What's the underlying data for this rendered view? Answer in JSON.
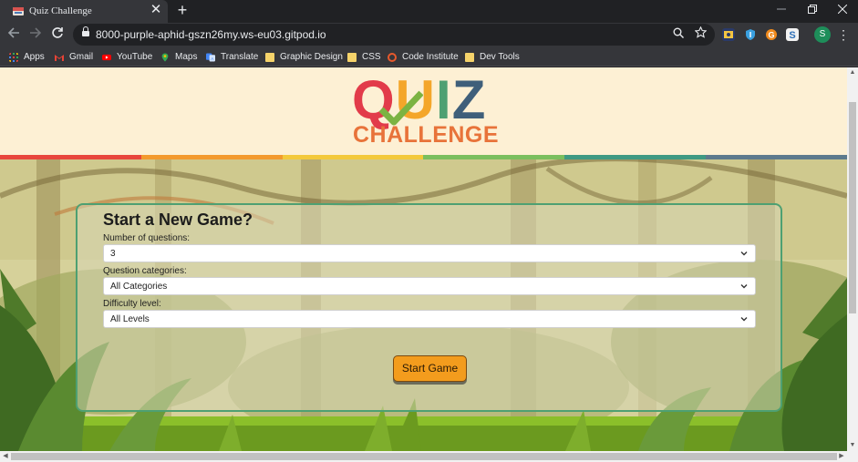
{
  "browser": {
    "tab_title": "Quiz Challenge",
    "tab_close": "✕",
    "new_tab": "+",
    "url": "8000-purple-aphid-gszn26my.ws-eu03.gitpod.io",
    "profile_initial": "S",
    "bookmarks": [
      {
        "label": "Apps",
        "icon": "apps-grid-icon"
      },
      {
        "label": "Gmail",
        "icon": "gmail-icon"
      },
      {
        "label": "YouTube",
        "icon": "youtube-icon"
      },
      {
        "label": "Maps",
        "icon": "maps-icon"
      },
      {
        "label": "Translate",
        "icon": "translate-icon"
      },
      {
        "label": "Graphic Design",
        "icon": "folder-icon"
      },
      {
        "label": "CSS",
        "icon": "folder-icon"
      },
      {
        "label": "Code Institute",
        "icon": "code-institute-icon"
      },
      {
        "label": "Dev Tools",
        "icon": "folder-icon"
      }
    ]
  },
  "page": {
    "logo": {
      "quiz_letters": [
        "Q",
        "U",
        "I",
        "Z"
      ],
      "challenge": "CHALLENGE"
    },
    "form": {
      "title": "Start a New Game?",
      "fields": [
        {
          "label": "Number of questions:",
          "value": "3"
        },
        {
          "label": "Question categories:",
          "value": "All Categories"
        },
        {
          "label": "Difficulty level:",
          "value": "All Levels"
        }
      ],
      "submit_label": "Start Game"
    }
  },
  "colors": {
    "logo_q": "#e23b4a",
    "logo_u": "#f4a62a",
    "logo_i": "#4ea072",
    "logo_z": "#3f5f7a",
    "challenge": "#e8733a",
    "stripe": [
      "#e8463c",
      "#f39a2d",
      "#f3c93b",
      "#7bbf5e",
      "#3f9a83",
      "#5d7a8d"
    ],
    "button": "#f39c1d",
    "card_border": "#4ea072"
  }
}
